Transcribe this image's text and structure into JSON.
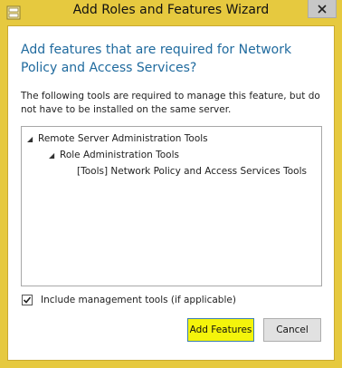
{
  "window": {
    "title": "Add Roles and Features Wizard",
    "accent_color": "#e6c93f",
    "highlight_color": "#f4f40b"
  },
  "dialog": {
    "heading": "Add features that are required for Network Policy and Access Services?",
    "description": "The following tools are required to manage this feature, but do not have to be installed on the same server.",
    "tree": [
      {
        "label": "Remote Server Administration Tools",
        "expanded": true
      },
      {
        "label": "Role Administration Tools",
        "expanded": true
      },
      {
        "label": "[Tools] Network Policy and Access Services Tools",
        "expanded": false
      }
    ],
    "include_tools": {
      "label": "Include management tools (if applicable)",
      "checked": true
    },
    "buttons": {
      "add": "Add Features",
      "cancel": "Cancel"
    }
  }
}
